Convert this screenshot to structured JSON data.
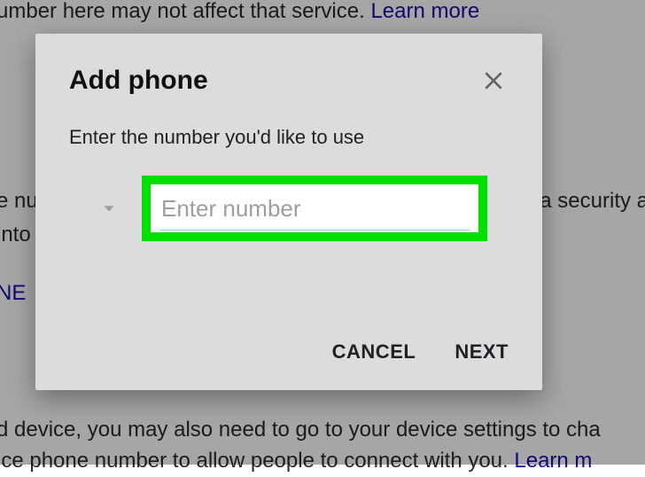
{
  "background": {
    "line1_a": "umber here may not affect that service. ",
    "line1_link": "Learn more",
    "line2_a": "e nu",
    "line2_b": "a security a",
    "line3": "into",
    "line4": "NE",
    "line5_a": "d device, you may also need to go to your device settings to cha",
    "line6_a": "ice phone number to allow people to connect with you. ",
    "line6_link": "Learn m"
  },
  "dialog": {
    "title": "Add phone",
    "prompt": "Enter the number you'd like to use",
    "input_placeholder": "Enter number",
    "cancel": "CANCEL",
    "next": "NEXT"
  }
}
